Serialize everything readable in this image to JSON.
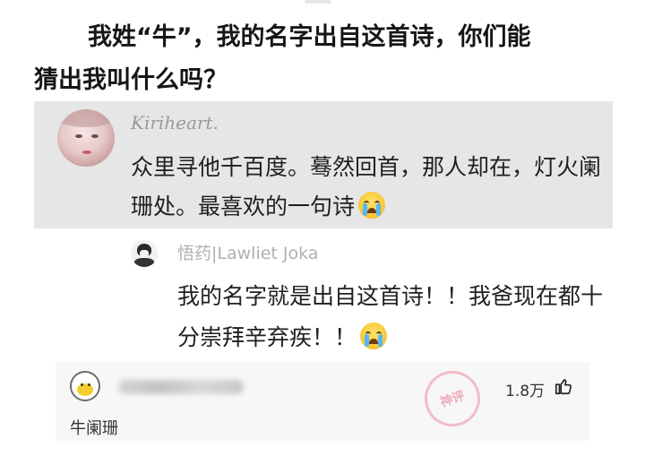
{
  "question": {
    "line1": "我姓“牛”，我的名字出自这首诗，你们能",
    "line2": "猜出我叫什么吗？"
  },
  "comment1": {
    "username": "Kiriheart.",
    "text": "众里寻他千百度。蓦然回首，那人却在，灯火阑珊处。最喜欢的一句诗",
    "emoji": "crying-face-icon"
  },
  "comment2": {
    "username": "悟药|Lawliet Joka",
    "text": "我的名字就是出自这首诗！！我爸现在都十分崇拜辛弃疾！！",
    "emoji": "crying-face-icon"
  },
  "reply": {
    "username_blurred": "",
    "likes": "1.8万",
    "text": "牛阑珊",
    "watermark": "神评"
  },
  "colors": {
    "comment_bg": "#e6e6e6",
    "reply_bg": "#f7f7f7",
    "username_gray": "#9a9a9a"
  }
}
